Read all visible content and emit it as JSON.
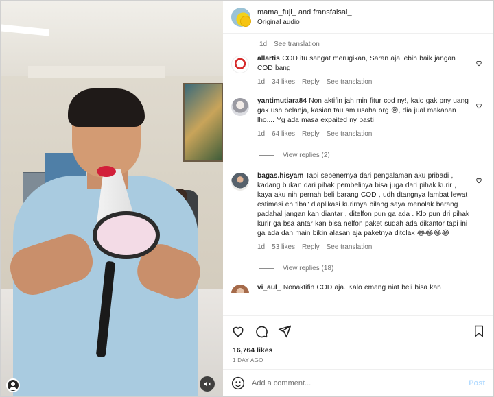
{
  "post": {
    "authors_label": "mama_fuji_ and fransfaisal_",
    "audio_label": "Original audio"
  },
  "caption_meta": {
    "time": "1d",
    "translate": "See translation"
  },
  "comments": [
    {
      "username": "allartis",
      "text": "COD itu sangat merugikan, Saran aja lebih baik jangan COD bang",
      "time": "1d",
      "likes": "34 likes",
      "reply": "Reply",
      "translate": "See translation",
      "avatar_color": "#d62b2b"
    },
    {
      "username": "yantimutiara84",
      "text": "Non aktifin jah min fitur cod ny!, kalo gak pny uang gak ush belanja, kasian tau sm usaha org 😢, dia jual makanan lho.... Yg ada masa expaited ny pasti",
      "time": "1d",
      "likes": "64 likes",
      "reply": "Reply",
      "translate": "See translation",
      "view_replies": "View replies (2)",
      "avatar_color": "#cfd0d4"
    },
    {
      "username": "bagas.hisyam",
      "text": "Tapi sebenernya dari pengalaman aku pribadi , kadang bukan dari pihak pembelinya bisa juga dari pihak kurir , kaya aku nih pernah beli barang COD , udh dtangnya lambat lewat estimasi eh tiba\" diaplikasi kurirnya bilang saya menolak barang padahal jangan kan diantar , ditelfon pun ga ada . Klo pun dri pihak kurir ga bsa antar kan bisa nelfon paket sudah ada dikantor tapi ini ga ada dan main bikin alasan aja paketnya ditolak 😂😂😂😂",
      "time": "1d",
      "likes": "53 likes",
      "reply": "Reply",
      "translate": "See translation",
      "view_replies": "View replies (18)",
      "avatar_color": "#56616b"
    },
    {
      "username": "vi_aul_",
      "text": "Nonaktifin COD aja. Kalo emang niat beli bisa kan",
      "avatar_color": "#a56a4a"
    }
  ],
  "actions": {
    "likes": "16,764 likes",
    "ago": "1 DAY AGO"
  },
  "composer": {
    "placeholder": "Add a comment...",
    "post_label": "Post"
  },
  "colors": {
    "text": "#262626",
    "muted": "#737373",
    "post_disabled": "#b3dbff",
    "megaphone_tip": "#d2203a"
  },
  "icons": [
    "heart-icon",
    "comment-icon",
    "share-icon",
    "bookmark-icon",
    "emoji-icon",
    "user-tag-icon",
    "sound-icon"
  ]
}
